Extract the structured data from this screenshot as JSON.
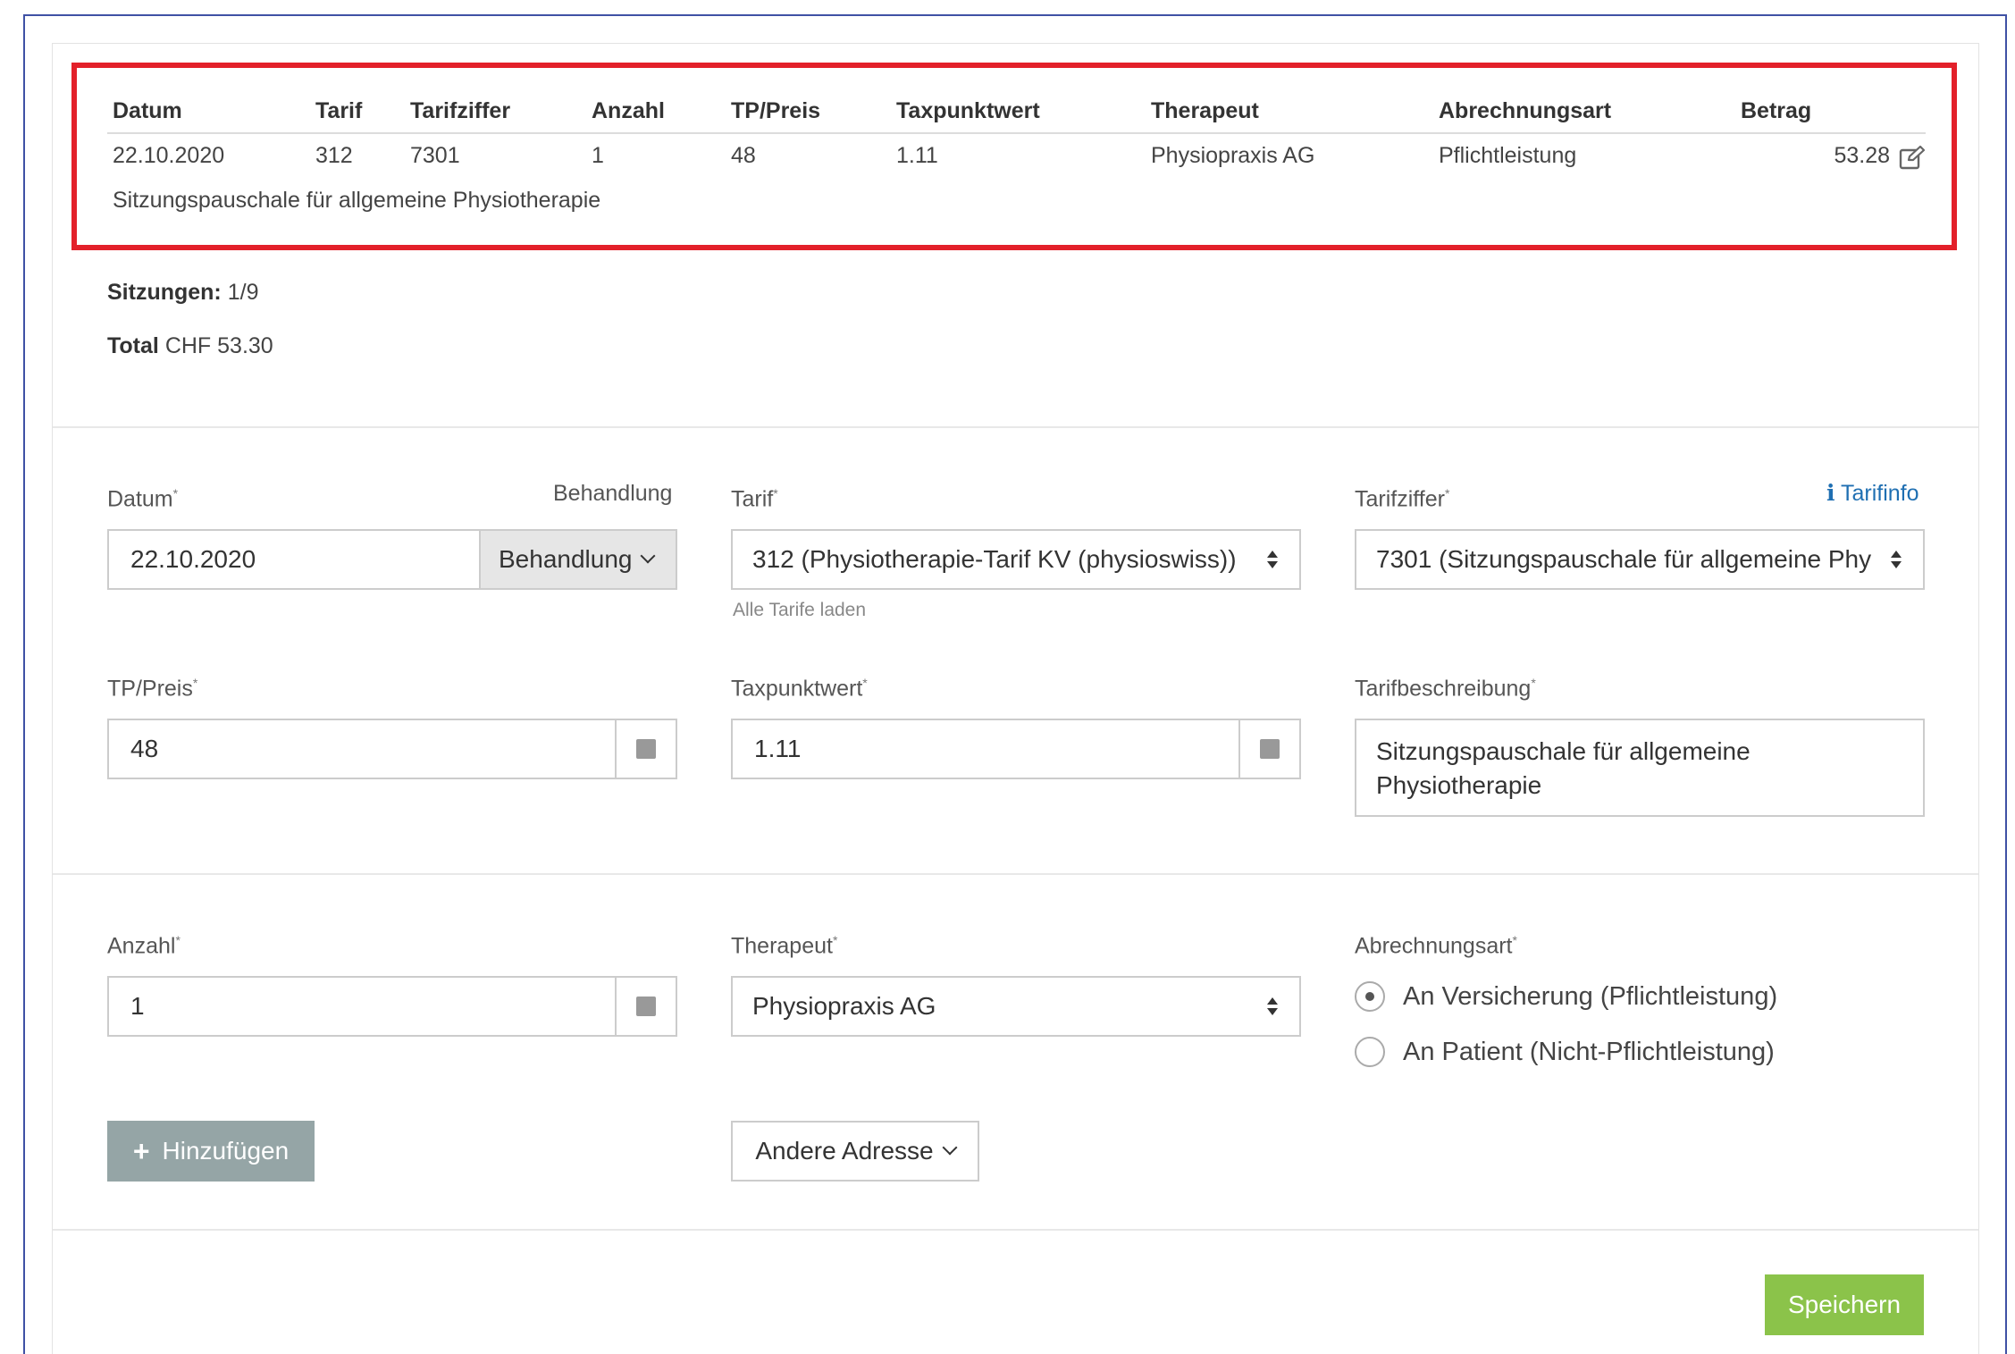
{
  "table": {
    "headers": [
      "Datum",
      "Tarif",
      "Tarifziffer",
      "Anzahl",
      "TP/Preis",
      "Taxpunktwert",
      "Therapeut",
      "Abrechnungsart",
      "Betrag"
    ],
    "row": {
      "datum": "22.10.2020",
      "tarif": "312",
      "tarifziffer": "7301",
      "anzahl": "1",
      "tp_preis": "48",
      "taxpunktwert": "1.11",
      "therapeut": "Physiopraxis AG",
      "abrechnungsart": "Pflichtleistung",
      "betrag": "53.28",
      "description": "Sitzungspauschale für allgemeine Physiotherapie"
    }
  },
  "summary": {
    "sessions_label": "Sitzungen:",
    "sessions_value": "1/9",
    "total_label": "Total",
    "total_value": "CHF 53.30"
  },
  "form": {
    "datum": {
      "label": "Datum",
      "value": "22.10.2020",
      "right_label": "Behandlung",
      "addon": "Behandlung"
    },
    "tarif": {
      "label": "Tarif",
      "value": "312 (Physiotherapie-Tarif KV (physioswiss))",
      "help": "Alle Tarife laden"
    },
    "tarifziffer": {
      "label": "Tarifziffer",
      "value": "7301 (Sitzungspauschale für allgemeine Phy",
      "link": "Tarifinfo"
    },
    "tp_preis": {
      "label": "TP/Preis",
      "value": "48"
    },
    "taxpunktwert": {
      "label": "Taxpunktwert",
      "value": "1.11"
    },
    "tarifbeschreibung": {
      "label": "Tarifbeschreibung",
      "line1": "Sitzungspauschale für allgemeine",
      "line2": "Physiotherapie"
    },
    "anzahl": {
      "label": "Anzahl",
      "value": "1"
    },
    "therapeut": {
      "label": "Therapeut",
      "value": "Physiopraxis AG"
    },
    "abrechnungsart": {
      "label": "Abrechnungsart",
      "options": [
        "An Versicherung (Pflichtleistung)",
        "An Patient (Nicht-Pflichtleistung)"
      ],
      "selected_index": 0
    },
    "required_marker": "*"
  },
  "buttons": {
    "add": "Hinzufügen",
    "other_address": "Andere Adresse",
    "save": "Speichern"
  },
  "icons": {
    "edit": "edit-icon",
    "info": "info-icon",
    "plus": "plus-icon",
    "select_arrows": "sort-arrows-icon",
    "chevron": "chevron-down-icon"
  },
  "colors": {
    "highlight": "#e3202a",
    "link": "#1f6fb2",
    "add_button": "#95a5a6",
    "save_button": "#8bc34a"
  }
}
